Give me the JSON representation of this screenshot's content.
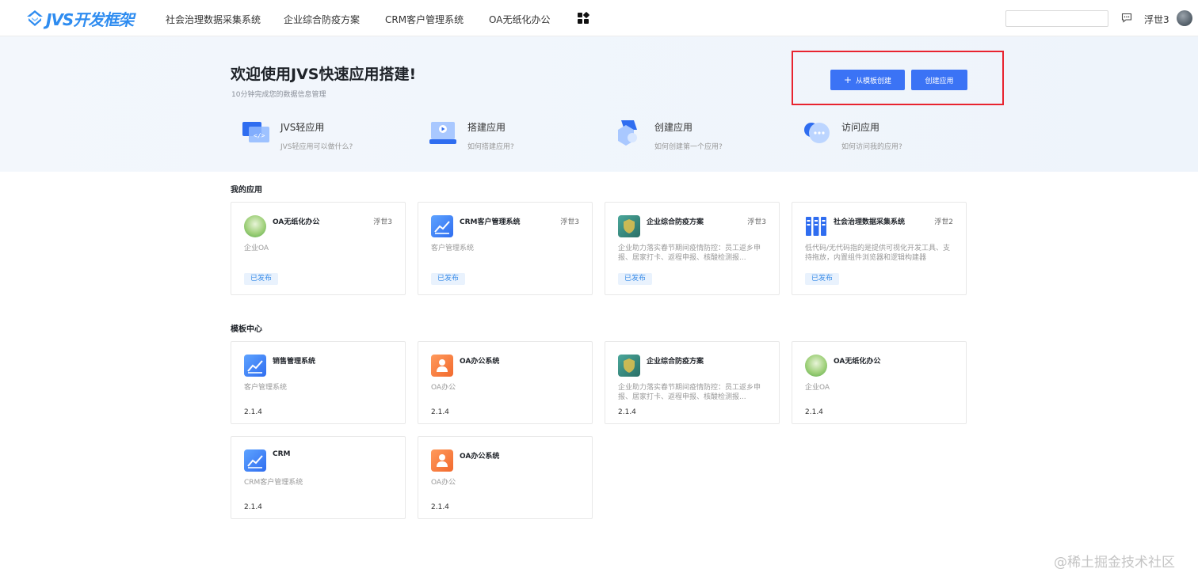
{
  "header": {
    "logo_text": "JVS开发框架",
    "nav": [
      {
        "label": "社会治理数据采集系统"
      },
      {
        "label": "企业综合防疫方案"
      },
      {
        "label": "CRM客户管理系统"
      },
      {
        "label": "OA无纸化办公"
      }
    ],
    "search": {
      "value": "",
      "placeholder": ""
    },
    "user_name": "浮世3",
    "apps_icon": "apps-grid-icon",
    "message_icon": "chat-bubble-icon"
  },
  "hero": {
    "title": "欢迎使用JVS快速应用搭建!",
    "subtitle": "10分钟完成您的数据信息管理",
    "template_button_label": "从模板创建",
    "template_button_icon": "+",
    "create_button_label": "创建应用",
    "accent_color": "#3b73f5",
    "highlight_color": "#e8232f"
  },
  "guides": [
    {
      "title": "JVS轻应用",
      "desc": "JVS轻应用可以做什么?",
      "icon": "code-window-icon"
    },
    {
      "title": "搭建应用",
      "desc": "如何搭建应用?",
      "icon": "play-screen-icon"
    },
    {
      "title": "创建应用",
      "desc": "如何创建第一个应用?",
      "icon": "cube-icon"
    },
    {
      "title": "访问应用",
      "desc": "如何访问我的应用?",
      "icon": "chat-dots-icon"
    }
  ],
  "my_apps": {
    "title": "我的应用",
    "items": [
      {
        "name": "OA无纸化办公",
        "owner": "浮世3",
        "desc": "企业OA",
        "tag": "已发布",
        "icon": "oa-landscape-icon"
      },
      {
        "name": "CRM客户管理系统",
        "owner": "浮世3",
        "desc": "客户管理系统",
        "tag": "已发布",
        "icon": "crm-chart-icon"
      },
      {
        "name": "企业综合防疫方案",
        "owner": "浮世3",
        "desc": "企业助力落实春节期间疫情防控：员工返乡申报、居家打卡、返程申报、核酸检测报...",
        "tag": "已发布",
        "icon": "epidemic-shield-icon"
      },
      {
        "name": "社会治理数据采集系统",
        "owner": "浮世2",
        "desc": "低代码/无代码指的是提供可视化开发工具、支持拖放，内置组件浏览器和逻辑构建器",
        "tag": "已发布",
        "icon": "data-columns-icon"
      }
    ]
  },
  "templates": {
    "title": "模板中心",
    "items": [
      {
        "name": "销售管理系统",
        "desc": "客户管理系统",
        "version": "2.1.4",
        "icon": "crm-chart-icon"
      },
      {
        "name": "OA办公系统",
        "desc": "OA办公",
        "version": "2.1.4",
        "icon": "oa-people-icon"
      },
      {
        "name": "企业综合防疫方案",
        "desc": "企业助力落实春节期间疫情防控：员工返乡申报、居家打卡、返程申报、核酸检测报...",
        "version": "2.1.4",
        "icon": "epidemic-shield-icon"
      },
      {
        "name": "OA无纸化办公",
        "desc": "企业OA",
        "version": "2.1.4",
        "icon": "oa-landscape-icon"
      },
      {
        "name": "CRM",
        "desc": "CRM客户管理系统",
        "version": "2.1.4",
        "icon": "crm-chart-icon"
      },
      {
        "name": "OA办公系统",
        "desc": "OA办公",
        "version": "2.1.4",
        "icon": "oa-people-icon"
      }
    ]
  },
  "watermark": "@稀土掘金技术社区"
}
